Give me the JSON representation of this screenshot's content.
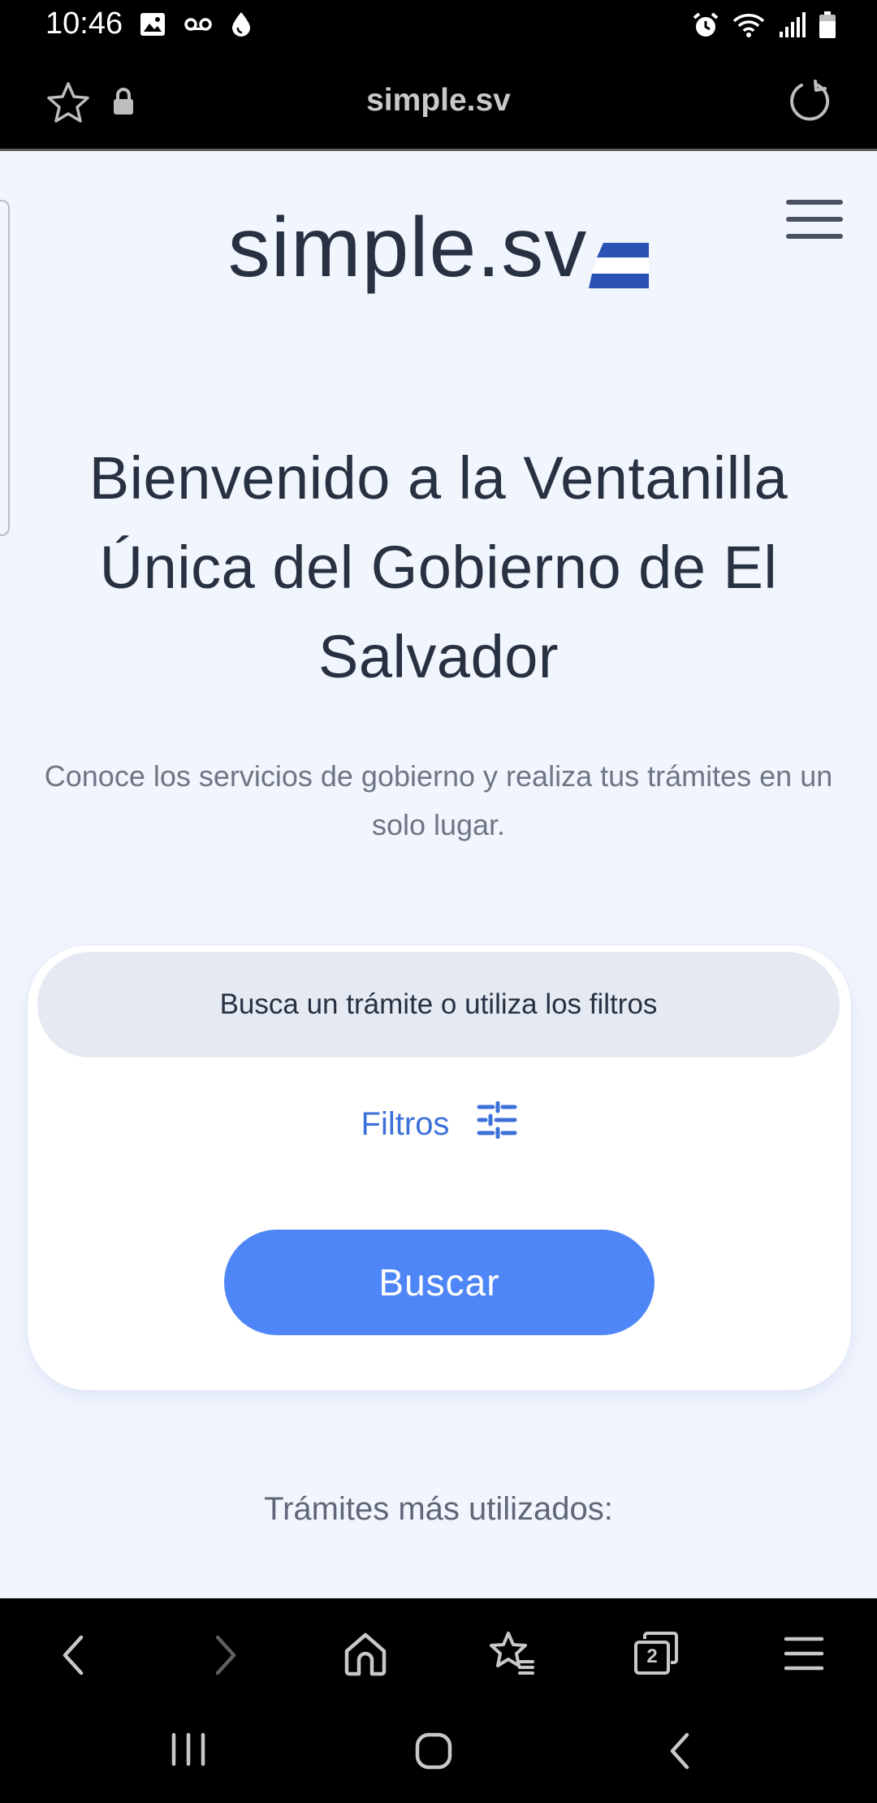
{
  "status_bar": {
    "time": "10:46",
    "left_icons": [
      "image-icon",
      "voicemail-icon",
      "drop-icon"
    ],
    "right_icons": [
      "alarm-icon",
      "wifi-icon",
      "signal-icon",
      "battery-icon"
    ]
  },
  "browser": {
    "url": "simple.sv",
    "bottom_toolbar": {
      "icons": [
        "back-icon",
        "forward-icon",
        "home-icon",
        "bookmarks-icon",
        "tabs-icon",
        "menu-icon"
      ],
      "tabs_count": "2"
    }
  },
  "page": {
    "logo_text": "simple.sv",
    "logo_flag_colors": [
      "#2a52b5",
      "#ffffff",
      "#2a52b5"
    ],
    "hero_title": "Bienvenido a la Ventanilla Única del Gobierno de El Salvador",
    "hero_subtitle": "Conoce los servicios de gobierno y realiza tus trámites en un solo lugar.",
    "search": {
      "placeholder": "Busca un trámite o utiliza los filtros",
      "filters_label": "Filtros",
      "button_label": "Buscar"
    },
    "most_used_heading": "Trámites más utilizados:"
  },
  "system_nav": {
    "icons": [
      "recents-icon",
      "home-circle-icon",
      "back-chevron-icon"
    ]
  },
  "colors": {
    "page_bg": "#f1f5fd",
    "text_dark": "#273142",
    "accent_blue": "#4e86f7",
    "link_blue": "#3d71d9",
    "input_bg": "#e4e9f2"
  }
}
